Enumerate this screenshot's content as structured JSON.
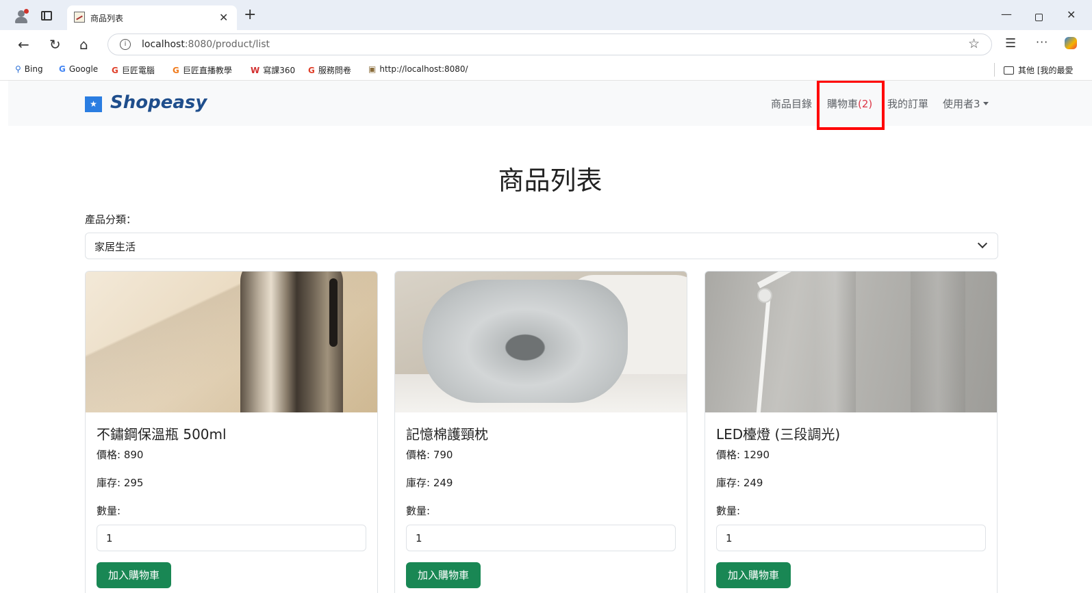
{
  "browser": {
    "tab_title": "商品列表",
    "url_host": "localhost",
    "url_rest": ":8080/product/list",
    "bookmarks": [
      {
        "icon": "search-icon",
        "label": "Bing"
      },
      {
        "icon": "google-icon",
        "label": "Google"
      },
      {
        "icon": "g-logo-icon",
        "label": "巨匠電腦"
      },
      {
        "icon": "g-logo-icon",
        "label": "巨匠直播教學"
      },
      {
        "icon": "w-logo-icon",
        "label": "寫課360"
      },
      {
        "icon": "g-logo-icon",
        "label": "服務問卷"
      },
      {
        "icon": "page-icon",
        "label": "http://localhost:8080/"
      }
    ],
    "bookmark_folder": "其他 [我的最愛"
  },
  "navbar": {
    "brand": "Shopeasy",
    "links": {
      "catalog": "商品目錄",
      "cart": "購物車",
      "cart_count": "(2)",
      "orders": "我的訂單",
      "user": "使用者3"
    }
  },
  "page": {
    "title": "商品列表",
    "category_label": "產品分類：",
    "category_selected": "家居生活"
  },
  "products": [
    {
      "name": "不鏽鋼保溫瓶 500ml",
      "price": "價格: 890",
      "stock": "庫存: 295",
      "qty_label": "數量:",
      "qty": "1",
      "button": "加入購物車"
    },
    {
      "name": "記憶棉護頸枕",
      "price": "價格: 790",
      "stock": "庫存: 249",
      "qty_label": "數量:",
      "qty": "1",
      "button": "加入購物車"
    },
    {
      "name": "LED檯燈 (三段調光)",
      "price": "價格: 1290",
      "stock": "庫存: 249",
      "qty_label": "數量:",
      "qty": "1",
      "button": "加入購物車"
    }
  ],
  "colors": {
    "brand_blue": "#1f4e8c",
    "cart_count": "#dc3545",
    "button_green": "#198754",
    "highlight": "#ff0000"
  }
}
